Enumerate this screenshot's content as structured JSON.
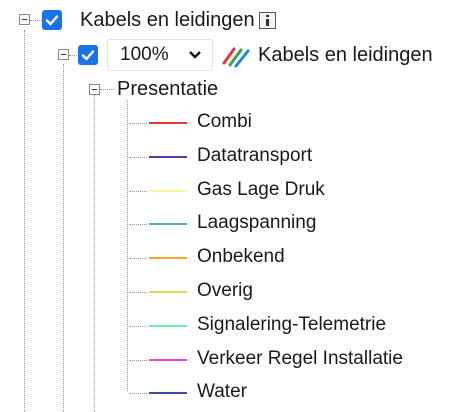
{
  "layer": {
    "title": "Kabels en leidingen",
    "sublayer": {
      "opacity": "100%",
      "title": "Kabels en leidingen",
      "group": "Presentatie",
      "legend": [
        {
          "label": "Combi",
          "color": "#e53935"
        },
        {
          "label": "Datatransport",
          "color": "#5e35b1"
        },
        {
          "label": "Gas Lage Druk",
          "color": "#fff59d"
        },
        {
          "label": "Laagspanning",
          "color": "#4db6ac"
        },
        {
          "label": "Onbekend",
          "color": "#ffa726"
        },
        {
          "label": "Overig",
          "color": "#d4e157"
        },
        {
          "label": "Signalering-Telemetrie",
          "color": "#69f0ae"
        },
        {
          "label": "Verkeer Regel Installatie",
          "color": "#ec40e0"
        },
        {
          "label": "Water",
          "color": "#3949ab"
        }
      ]
    }
  },
  "colors": {
    "checkbox": "#1a73e8"
  }
}
